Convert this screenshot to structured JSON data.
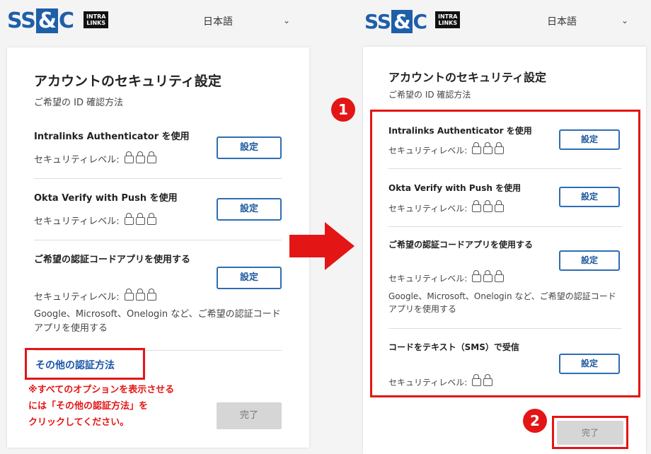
{
  "header": {
    "logo_ssc_left": "SS",
    "logo_ssc_amp": "&",
    "logo_ssc_right": "C",
    "logo_intralinks_line1": "INTRA",
    "logo_intralinks_line2": "LINKS",
    "language": "日本語"
  },
  "card": {
    "title": "アカウントのセキュリティ設定",
    "subtitle": "ご希望の ID 確認方法",
    "setup_label": "設定",
    "level_label": "セキュリティレベル:",
    "done_label": "完了"
  },
  "options": [
    {
      "name": "Intralinks Authenticator を使用",
      "locks": 3
    },
    {
      "name": "Okta Verify with Push を使用",
      "locks": 3
    },
    {
      "name": "ご希望の認証コードアプリを使用する",
      "locks": 3,
      "desc": "Google、Microsoft、Onelogin など、ご希望の認証コードアプリを使用する"
    },
    {
      "name": "コードをテキスト（SMS）で受信",
      "locks": 2
    }
  ],
  "left": {
    "other_methods_link": "その他の認証方法",
    "note_line1": "※すべてのオプションを表示させる",
    "note_line2": "には「その他の認証方法」を",
    "note_line3": "クリックしてください。"
  },
  "badges": {
    "one": "1",
    "two": "2"
  },
  "colors": {
    "brand": "#1e5fa8",
    "highlight": "#e41515",
    "button_border": "#2e6db4",
    "done_bg": "#d6d6d6"
  }
}
